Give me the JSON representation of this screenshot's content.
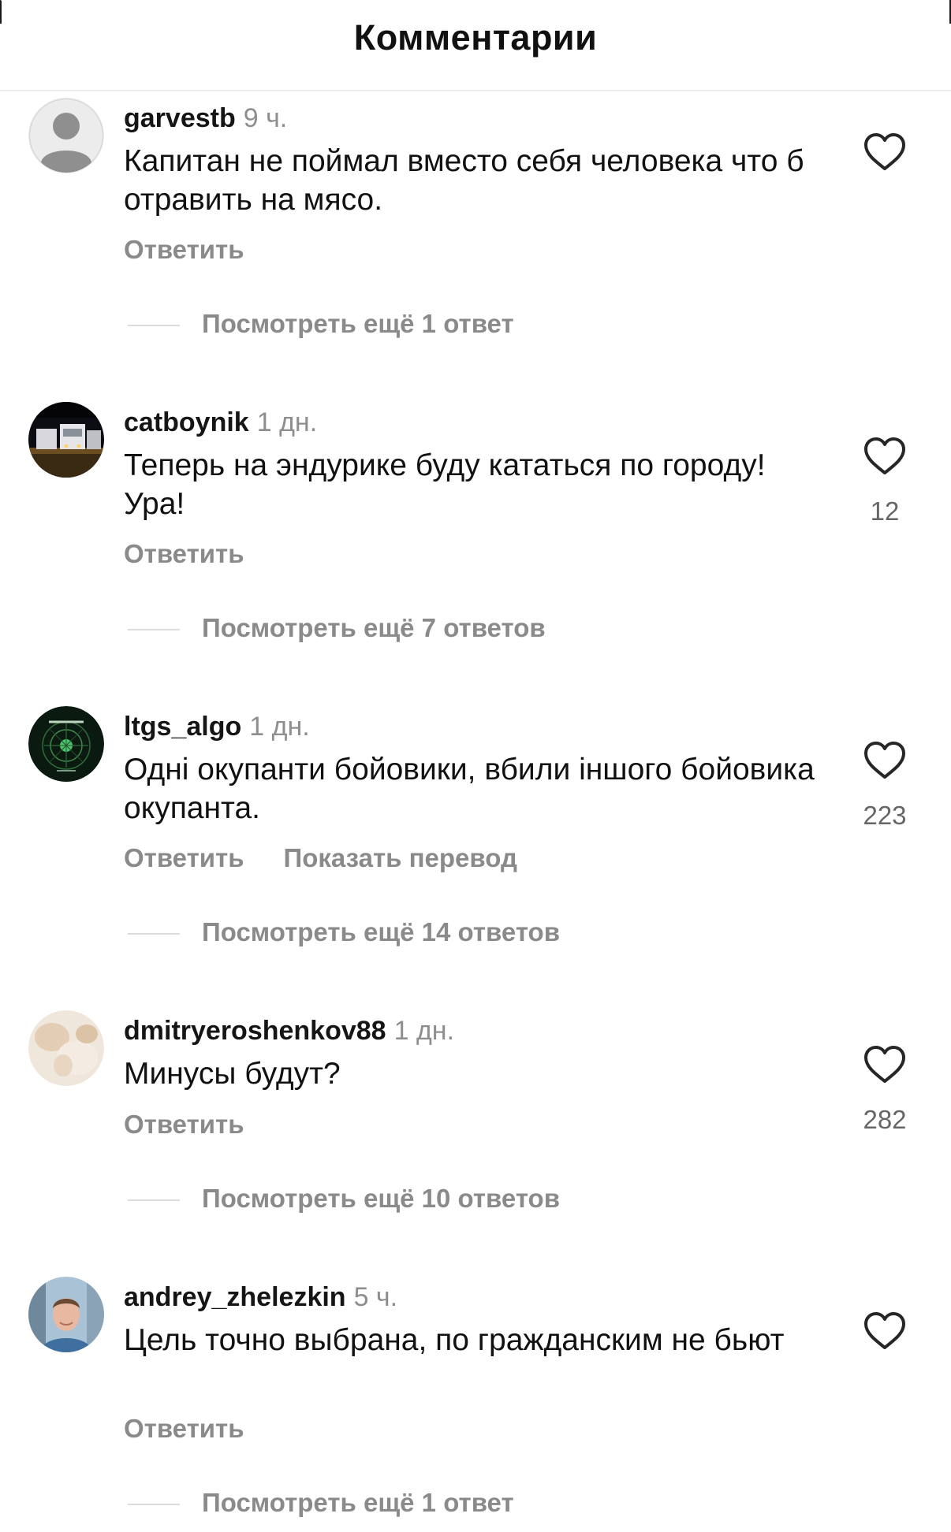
{
  "header": {
    "title": "Комментарии"
  },
  "comments": [
    {
      "username": "garvestb",
      "time": "9 ч.",
      "text": "Капитан не поймал вместо себя человека что б отравить на мясо.",
      "reply_label": "Ответить",
      "likes": "",
      "view_replies": "Посмотреть ещё 1 ответ",
      "avatar_icon": "default-user-icon"
    },
    {
      "username": "catboynik",
      "time": "1 дн.",
      "text": "Теперь на эндурике буду кататься по городу! Ура!",
      "reply_label": "Ответить",
      "likes": "12",
      "view_replies": "Посмотреть ещё 7 ответов",
      "avatar_icon": "trucks-at-night-photo"
    },
    {
      "username": "ltgs_algo",
      "time": "1 дн.",
      "text": "Одні окупанти бойовики, вбили іншого бойовика окупанта.",
      "reply_label": "Ответить",
      "translate_label": "Показать перевод",
      "likes": "223",
      "view_replies": "Посмотреть ещё 14 ответов",
      "avatar_icon": "ltgs-algo-logo"
    },
    {
      "username": "dmitryeroshenkov88",
      "time": "1 дн.",
      "text": "Минусы будут?",
      "reply_label": "Ответить",
      "likes": "282",
      "view_replies": "Посмотреть ещё 10 ответов",
      "avatar_icon": "blurred-photo"
    },
    {
      "username": "andrey_zhelezkin",
      "time": "5 ч.",
      "text": "Цель точно выбрана, по гражданским не бьют",
      "reply_label": "Ответить",
      "likes": "",
      "view_replies": "Посмотреть ещё 1 ответ",
      "avatar_icon": "portrait-photo"
    }
  ],
  "colors": {
    "text": "#111111",
    "secondary": "#8a8a8a",
    "divider": "#dcdcdc",
    "heart_outline": "#262626"
  }
}
